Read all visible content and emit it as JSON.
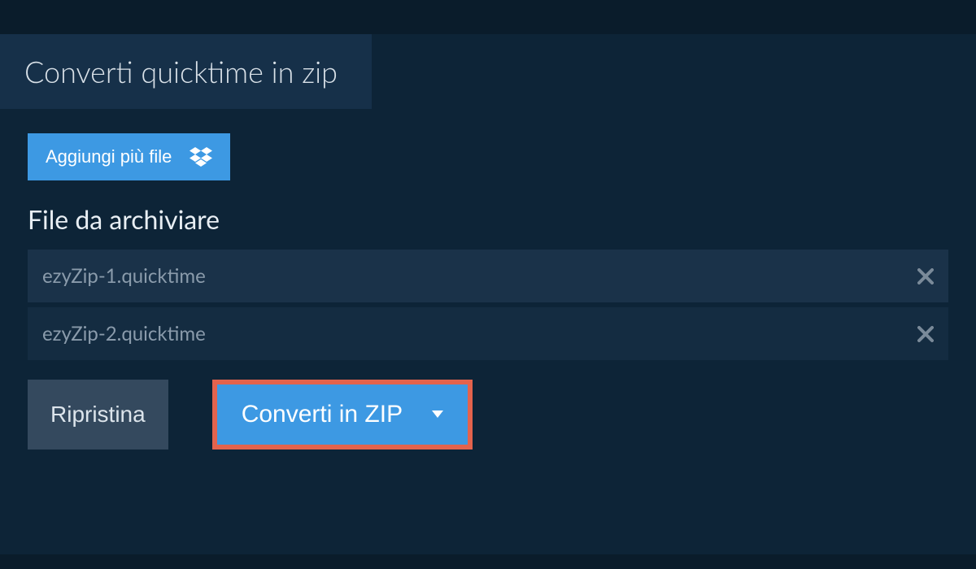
{
  "tab": {
    "title": "Converti quicktime in zip"
  },
  "addFiles": {
    "label": "Aggiungi più file"
  },
  "section": {
    "title": "File da archiviare"
  },
  "files": [
    {
      "name": "ezyZip-1.quicktime"
    },
    {
      "name": "ezyZip-2.quicktime"
    }
  ],
  "actions": {
    "reset": "Ripristina",
    "convert": "Converti in ZIP"
  }
}
